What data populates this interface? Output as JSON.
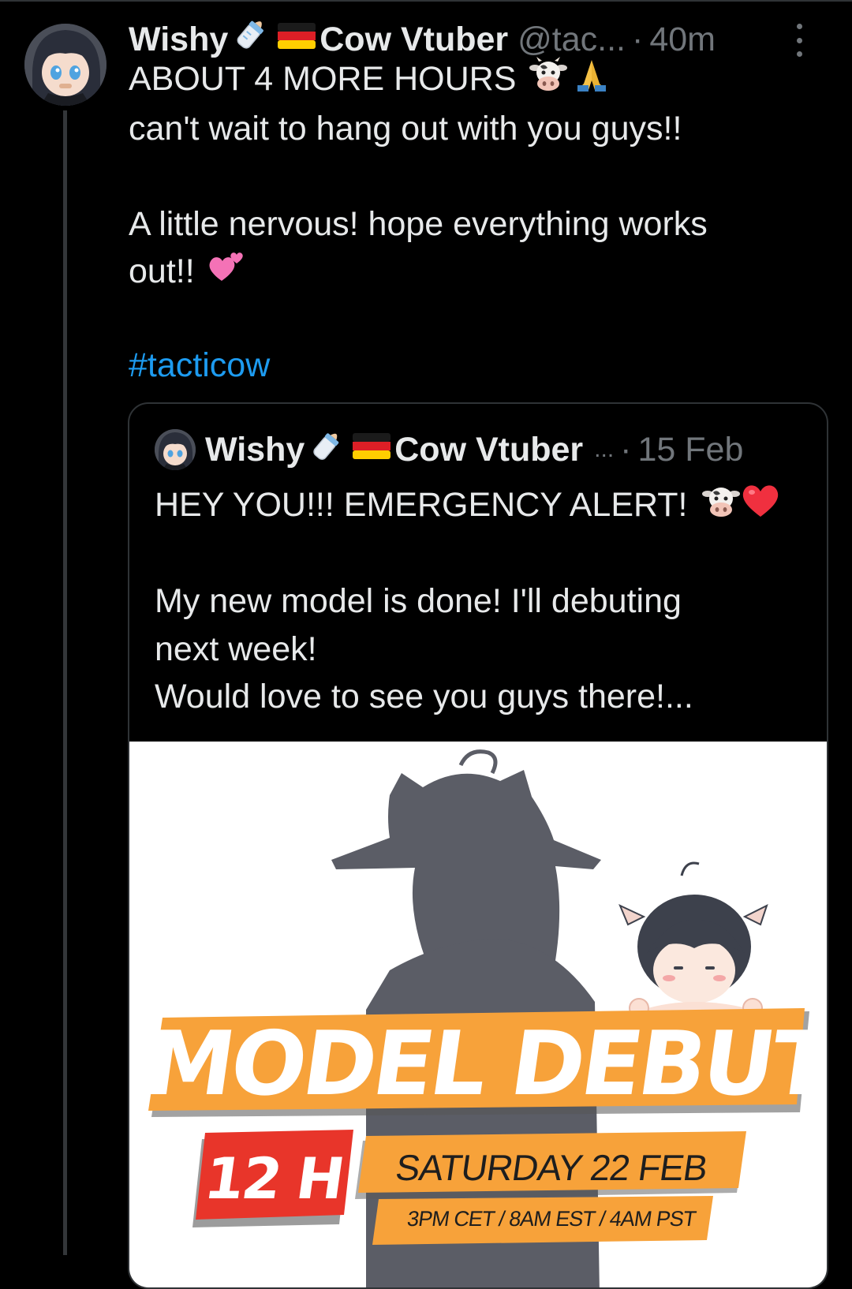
{
  "tweet": {
    "display_name": "Wishy",
    "display_name_suffix": "Cow Vtuber",
    "handle": "@tac...",
    "separator": "·",
    "time": "40m",
    "lines": [
      "ABOUT 4 MORE HOURS",
      "can't wait to hang out with you guys!!",
      "A little nervous! hope everything works",
      "out!!"
    ],
    "hashtag": "#tacticow",
    "emoji": {
      "name_1": "baby-bottle",
      "name_2": "germany-flag",
      "line1_a": "cow-face",
      "line1_b": "folded-hands",
      "line4": "two-hearts"
    }
  },
  "quote": {
    "display_name": "Wishy",
    "display_name_suffix": "Cow Vtuber",
    "ellipsis": "...",
    "separator": "·",
    "date": "15 Feb",
    "lines": [
      "HEY YOU!!! EMERGENCY ALERT!",
      "My new model is done! I'll debuting",
      "next week!",
      "Would love to see you guys there!..."
    ],
    "emoji": {
      "line1_a": "cow-face",
      "line1_b": "red-heart"
    },
    "media": {
      "banner_title": "MODEL DEBUT",
      "countdown": "12 H",
      "date": "SATURDAY 22 FEB",
      "times": "3PM CET / 8AM EST / 4AM PST",
      "colors": {
        "banner": "#f7a23a",
        "badge": "#e8352a",
        "silhouette": "#5b5d66"
      }
    }
  },
  "colors": {
    "background": "#000000",
    "text": "#e7e9ea",
    "muted": "#71767b",
    "link": "#1d9bf0",
    "border": "#2f3336"
  }
}
